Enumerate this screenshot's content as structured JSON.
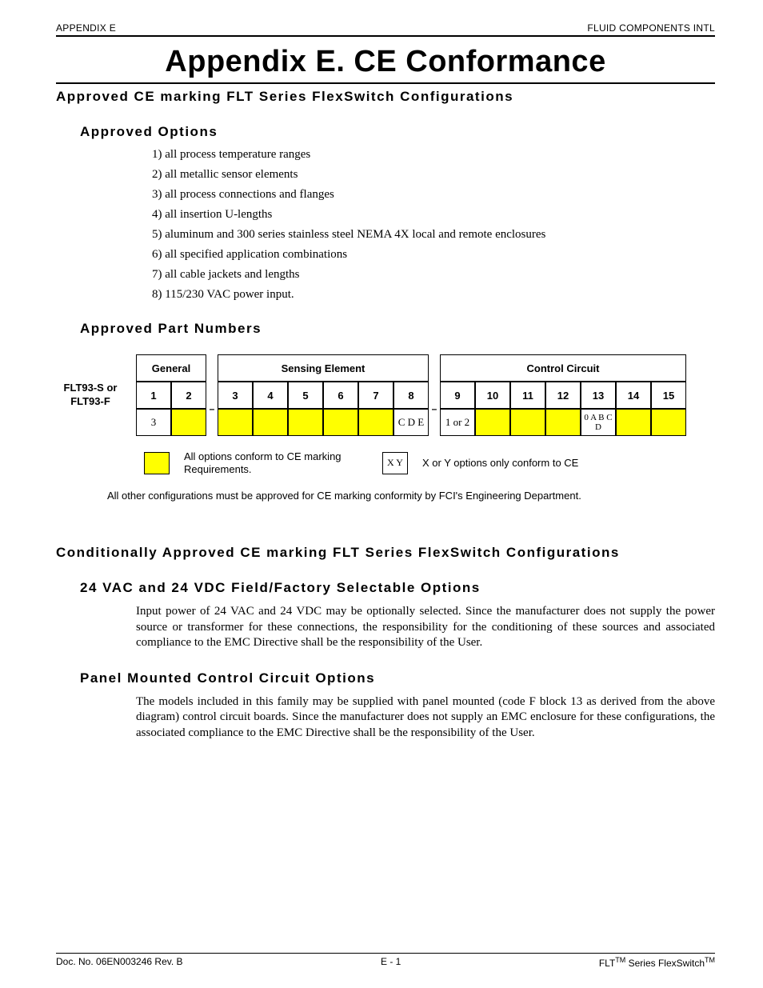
{
  "header": {
    "left": "APPENDIX E",
    "right": "FLUID COMPONENTS INTL"
  },
  "title": "Appendix E.  CE Conformance",
  "h2_1": "Approved CE marking FLT Series FlexSwitch Configurations",
  "h3_opts": "Approved Options",
  "options": [
    "1) all process temperature ranges",
    "2) all metallic sensor elements",
    "3) all process connections and flanges",
    "4) all insertion U-lengths",
    "5) aluminum and 300 series stainless steel NEMA 4X local and remote enclosures",
    "6) all specified application combinations",
    "7) all cable jackets and lengths",
    "8) 115/230 VAC power input."
  ],
  "h3_parts": "Approved Part Numbers",
  "row_label": "FLT93-S or FLT93-F",
  "groups": {
    "g1": "General",
    "g2": "Sensing Element",
    "g3": "Control Circuit"
  },
  "cols": [
    "1",
    "2",
    "3",
    "4",
    "5",
    "6",
    "7",
    "8",
    "9",
    "10",
    "11",
    "12",
    "13",
    "14",
    "15"
  ],
  "vals": {
    "c1": "3",
    "c2": "",
    "c3": "",
    "c4": "",
    "c5": "",
    "c6": "",
    "c7": "",
    "c8": "C D E",
    "c9": "1 or 2",
    "c10": "",
    "c11": "",
    "c12": "",
    "c13": "0 A B C D",
    "c14": "",
    "c15": ""
  },
  "yellow": {
    "c2": true,
    "c3": true,
    "c4": true,
    "c5": true,
    "c6": true,
    "c7": true,
    "c10": true,
    "c11": true,
    "c12": true,
    "c14": true,
    "c15": true
  },
  "legend": {
    "a": "All options conform to CE marking Requirements.",
    "b_key": "X Y",
    "b": "X or Y options only conform to CE"
  },
  "note": "All other configurations must be approved for CE marking conformity by FCI's Engineering Department.",
  "h2_2": "Conditionally Approved CE marking FLT Series FlexSwitch Configurations",
  "h3_24v": "24 VAC and 24 VDC Field/Factory Selectable Options",
  "p_24v": "Input power of 24 VAC and 24 VDC may be optionally selected.   Since the manufacturer does not supply the power source or transformer for these connections, the responsibility for the conditioning of these sources and associated compliance to the EMC Directive shall be the responsibility of the User.",
  "h3_panel": "Panel Mounted Control Circuit Options",
  "p_panel": "The models included in this family may be supplied with panel mounted (code F block 13 as derived from the above diagram) control circuit boards.  Since the manufacturer does not supply an EMC enclosure for these configurations, the associated compliance to the EMC Directive shall be the responsibility of the User.",
  "footer": {
    "left": "Doc. No. 06EN003246 Rev. B",
    "center": "E - 1",
    "right_a": "FLT",
    "right_b": " Series FlexSwitch",
    "tm": "TM"
  }
}
